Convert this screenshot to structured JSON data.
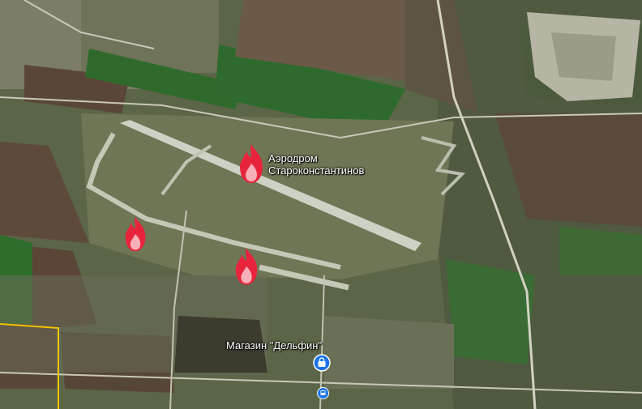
{
  "labels": {
    "airfield_line1": "Аэродром",
    "airfield_line2": "Староконстантинов",
    "shop": "Магазин \"Дельфин\""
  },
  "markers": {
    "fire_icon": "fire-icon",
    "shop_icon": "shopping-bag-icon",
    "transit_icon": "bus-stop-icon"
  },
  "colors": {
    "fire": "#e8243c",
    "pin": "#1a73e8",
    "runway": "#c9cfc0",
    "boundary": "#f2c200"
  }
}
